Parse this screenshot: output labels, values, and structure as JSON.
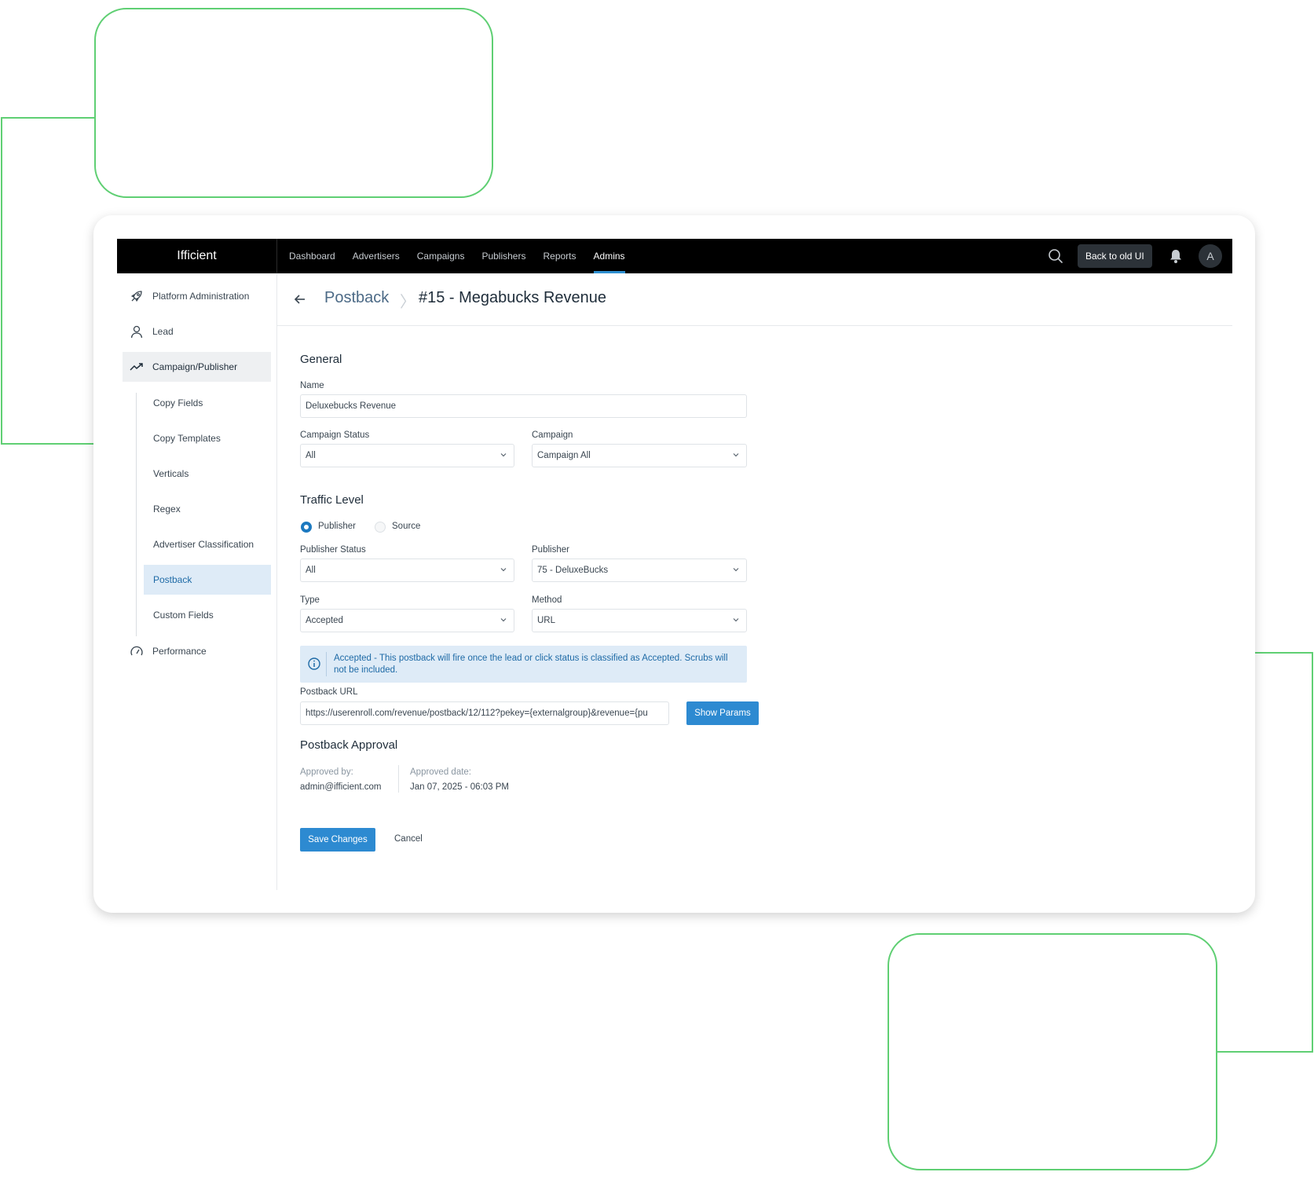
{
  "app": {
    "brand": "Ifficient",
    "nav": [
      "Dashboard",
      "Advertisers",
      "Campaigns",
      "Publishers",
      "Reports",
      "Admins"
    ],
    "active_nav": "Admins",
    "back_to_old_ui": "Back to old UI",
    "avatar_initial": "A"
  },
  "sidebar": {
    "items": [
      {
        "label": "Platform Administration",
        "icon": "rocket-icon"
      },
      {
        "label": "Lead",
        "icon": "user-icon"
      },
      {
        "label": "Campaign/Publisher",
        "icon": "trend-up-icon"
      },
      {
        "label": "Performance",
        "icon": "gauge-icon"
      }
    ],
    "sub_items": [
      "Copy Fields",
      "Copy Templates",
      "Verticals",
      "Regex",
      "Advertiser Classification",
      "Postback",
      "Custom Fields"
    ],
    "active_sub": "Postback"
  },
  "breadcrumb": {
    "parent": "Postback",
    "separator": "〉",
    "current": "#15 - Megabucks Revenue"
  },
  "form": {
    "general_title": "General",
    "name_label": "Name",
    "name_value": "Deluxebucks Revenue",
    "campaign_status_label": "Campaign Status",
    "campaign_status_value": "All",
    "campaign_label": "Campaign",
    "campaign_value": "Campaign All",
    "traffic_title": "Traffic Level",
    "traffic_options": [
      "Publisher",
      "Source"
    ],
    "traffic_selected": "Publisher",
    "publisher_status_label": "Publisher Status",
    "publisher_status_value": "All",
    "publisher_label": "Publisher",
    "publisher_value": "75 - DeluxeBucks",
    "type_label": "Type",
    "type_value": "Accepted",
    "method_label": "Method",
    "method_value": "URL",
    "info_text": "Accepted - This postback will fire once the lead or click status is classified as Accepted. Scrubs will not be included.",
    "postback_url_label": "Postback URL",
    "postback_url_value": "https://userenroll.com/revenue/postback/12/112?pekey={externalgroup}&revenue={pu",
    "show_params": "Show Params"
  },
  "approval": {
    "title": "Postback Approval",
    "approved_by_label": "Approved by:",
    "approved_by": "admin@ifficient.com",
    "approved_date_label": "Approved date:",
    "approved_date": "Jan 07, 2025 - 06:03 PM"
  },
  "actions": {
    "save": "Save Changes",
    "cancel": "Cancel"
  },
  "colors": {
    "accent": "#2d8ad1",
    "decor_outline": "#5fcf73",
    "topbar": "#000000"
  }
}
